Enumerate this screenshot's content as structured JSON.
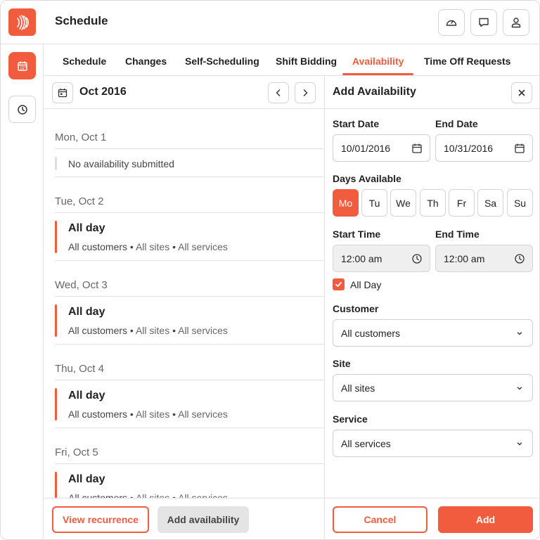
{
  "header": {
    "title": "Schedule"
  },
  "icons": {
    "logo": "signal-waves-icon",
    "dashboard": "speedometer-icon",
    "messages": "chat-icon",
    "profile": "user-icon",
    "rail_schedule": "calendar-icon",
    "rail_time": "clock-icon"
  },
  "tabs": [
    {
      "label": "Schedule"
    },
    {
      "label": "Changes"
    },
    {
      "label": "Self-Scheduling"
    },
    {
      "label": "Shift Bidding"
    },
    {
      "label": "Availability",
      "active": true
    },
    {
      "label": "Time Off Requests"
    }
  ],
  "list": {
    "month": "Oct 2016",
    "days": [
      {
        "title": "Mon, Oct 1",
        "empty_text": "No availability submitted"
      },
      {
        "title": "Tue, Oct 2",
        "entry_title": "All day",
        "customer": "All customers",
        "site": "All sites",
        "service": "All services"
      },
      {
        "title": "Wed, Oct 3",
        "entry_title": "All day",
        "customer": "All customers",
        "site": "All sites",
        "service": "All services"
      },
      {
        "title": "Thu, Oct 4",
        "entry_title": "All day",
        "customer": "All customers",
        "site": "All sites",
        "service": "All services"
      },
      {
        "title": "Fri, Oct 5",
        "entry_title": "All day",
        "customer": "All customers",
        "site": "All sites",
        "service": "All services"
      }
    ],
    "separator": "•",
    "view_recurrence": "View recurrence",
    "add_availability": "Add availability"
  },
  "form": {
    "title": "Add Availability",
    "start_date_label": "Start Date",
    "start_date": "10/01/2016",
    "end_date_label": "End Date",
    "end_date": "10/31/2016",
    "days_label": "Days Available",
    "days": [
      {
        "label": "Mo",
        "selected": true
      },
      {
        "label": "Tu",
        "selected": false
      },
      {
        "label": "We",
        "selected": false
      },
      {
        "label": "Th",
        "selected": false
      },
      {
        "label": "Fr",
        "selected": false
      },
      {
        "label": "Sa",
        "selected": false
      },
      {
        "label": "Su",
        "selected": false
      }
    ],
    "start_time_label": "Start Time",
    "start_time": "12:00 am",
    "end_time_label": "End Time",
    "end_time": "12:00 am",
    "all_day_label": "All Day",
    "all_day": true,
    "customer_label": "Customer",
    "customer": "All customers",
    "site_label": "Site",
    "site": "All sites",
    "service_label": "Service",
    "service": "All services",
    "cancel": "Cancel",
    "add": "Add"
  },
  "colors": {
    "accent": "#f25c3e",
    "border": "#e2e2e2",
    "disabled_field": "#efefef"
  }
}
